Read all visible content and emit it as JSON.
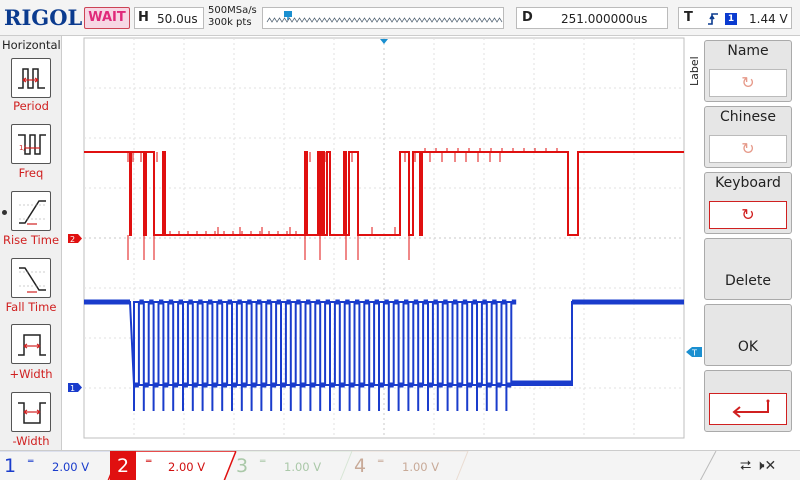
{
  "header": {
    "brand": "RIGOL",
    "status": "WAIT",
    "horizontal_label": "H",
    "timebase": "50.0us",
    "sample_rate": "500MSa/s",
    "memory_depth": "300k pts",
    "delay_label": "D",
    "delay_value": "251.000000us",
    "trigger_label": "T",
    "trigger_edge_icon": "rising-edge-icon",
    "trigger_source": "1",
    "trigger_level": "1.44 V"
  },
  "left_menu": {
    "title": "Horizontal",
    "items": [
      {
        "label": "Period",
        "icon": "period-measure-icon"
      },
      {
        "label": "Freq",
        "icon": "frequency-measure-icon"
      },
      {
        "label": "Rise Time",
        "icon": "rise-time-icon"
      },
      {
        "label": "Fall Time",
        "icon": "fall-time-icon"
      },
      {
        "label": "+Width",
        "icon": "positive-width-icon"
      },
      {
        "label": "-Width",
        "icon": "negative-width-icon"
      }
    ]
  },
  "right_menu": {
    "side_label": "Label",
    "items": [
      {
        "label": "Name",
        "icon": "undo-icon",
        "state": "disabled"
      },
      {
        "label": "Chinese",
        "icon": "undo-icon",
        "state": "disabled"
      },
      {
        "label": "Keyboard",
        "icon": "undo-icon",
        "state": "active"
      },
      {
        "label": "Delete",
        "icon": "",
        "state": "plain"
      },
      {
        "label": "OK",
        "icon": "",
        "state": "plain"
      },
      {
        "label": "",
        "icon": "enter-icon",
        "state": "enter"
      }
    ]
  },
  "channels": [
    {
      "number": "1",
      "coupling_icon": "dc-coupling-icon",
      "scale": "2.00 V",
      "color": "#1a3ccc",
      "enabled": true
    },
    {
      "number": "2",
      "coupling_icon": "dc-coupling-icon",
      "scale": "2.00 V",
      "color": "#e01010",
      "enabled": true,
      "selected": true
    },
    {
      "number": "3",
      "coupling_icon": "dc-coupling-icon",
      "scale": "1.00 V",
      "color": "#aac8a8",
      "enabled": false
    },
    {
      "number": "4",
      "coupling_icon": "dc-coupling-icon",
      "scale": "1.00 V",
      "color": "#c8aa98",
      "enabled": false
    }
  ],
  "markers": {
    "ch1": "1",
    "ch2": "2",
    "trigger": "T"
  },
  "colors": {
    "ch1": "#1a3ccc",
    "ch2": "#e01010",
    "grid": "#d9d9d9",
    "accent": "#0b3b8f"
  },
  "status_icons": [
    "usb-icon",
    "speaker-mute-icon"
  ]
}
